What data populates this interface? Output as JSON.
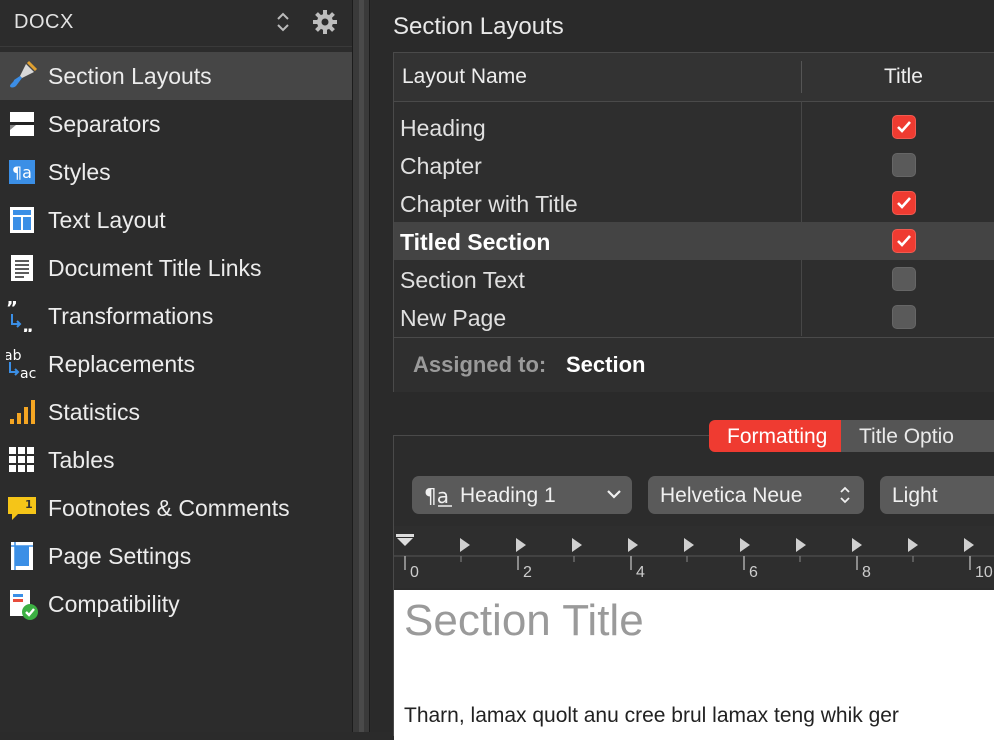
{
  "sidebar": {
    "title": "DOCX",
    "items": [
      {
        "label": "Section Layouts",
        "icon": "paintbrush-icon",
        "active": true
      },
      {
        "label": "Separators",
        "icon": "separator-icon"
      },
      {
        "label": "Styles",
        "icon": "paragraph-style-icon"
      },
      {
        "label": "Text Layout",
        "icon": "text-layout-icon"
      },
      {
        "label": "Document Title Links",
        "icon": "document-icon"
      },
      {
        "label": "Transformations",
        "icon": "quote-transform-icon"
      },
      {
        "label": "Replacements",
        "icon": "replace-icon"
      },
      {
        "label": "Statistics",
        "icon": "bar-chart-icon"
      },
      {
        "label": "Tables",
        "icon": "table-icon"
      },
      {
        "label": "Footnotes & Comments",
        "icon": "comment-icon"
      },
      {
        "label": "Page Settings",
        "icon": "page-settings-icon"
      },
      {
        "label": "Compatibility",
        "icon": "compatibility-check-icon"
      }
    ]
  },
  "main": {
    "heading": "Section Layouts",
    "table": {
      "columns": [
        "Layout Name",
        "Title"
      ],
      "rows": [
        {
          "name": "Heading",
          "title": true,
          "selected": false
        },
        {
          "name": "Chapter",
          "title": false,
          "selected": false
        },
        {
          "name": "Chapter with Title",
          "title": true,
          "selected": false
        },
        {
          "name": "Titled Section",
          "title": true,
          "selected": true
        },
        {
          "name": "Section Text",
          "title": false,
          "selected": false
        },
        {
          "name": "New Page",
          "title": false,
          "selected": false
        }
      ]
    },
    "assigned_label": "Assigned to:",
    "assigned_value": "Section"
  },
  "formatting": {
    "tabs": [
      {
        "label": "Formatting",
        "active": true
      },
      {
        "label": "Title Optio",
        "active": false
      }
    ],
    "style_select": "Heading 1",
    "font_select": "Helvetica Neue",
    "weight_select": "Light",
    "ruler_labels": [
      "0",
      "2",
      "4",
      "6",
      "8",
      "10"
    ],
    "preview_title": "Section Title",
    "preview_body": "Tharn, lamax quolt anu cree brul lamax teng whik ger"
  },
  "colors": {
    "accent": "#ef3b31",
    "panel": "#2c2c2c",
    "selected_row": "#444444"
  }
}
